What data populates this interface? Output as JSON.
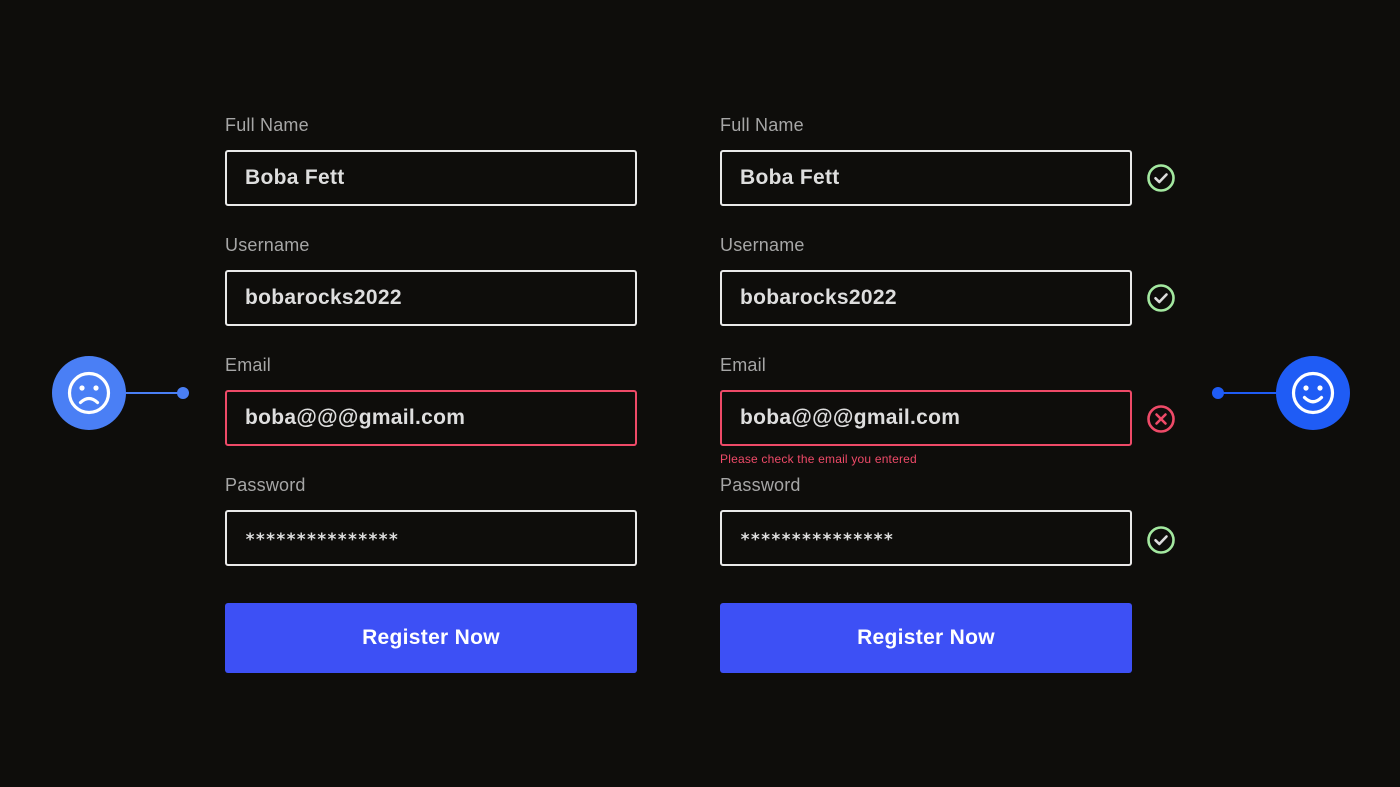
{
  "colors": {
    "background": "#0e0d0b",
    "field_border": "#e9e9e9",
    "error": "#ee4a68",
    "success": "#a3e8a0",
    "button": "#3d50f5",
    "sad_face": "#4a7ff5",
    "happy_face": "#1f5cf5"
  },
  "forms": {
    "left": {
      "full_name_label": "Full Name",
      "full_name_value": "Boba Fett",
      "username_label": "Username",
      "username_value": "bobarocks2022",
      "email_label": "Email",
      "email_value": "boba@@@gmail.com",
      "password_label": "Password",
      "password_value": "***************",
      "submit_label": "Register Now"
    },
    "right": {
      "full_name_label": "Full Name",
      "full_name_value": "Boba Fett",
      "username_label": "Username",
      "username_value": "bobarocks2022",
      "email_label": "Email",
      "email_value": "boba@@@gmail.com",
      "email_error": "Please check the email you entered",
      "password_label": "Password",
      "password_value": "***************",
      "submit_label": "Register Now"
    }
  },
  "icons": {
    "left_indicator": "sad-face-icon",
    "right_indicator": "happy-face-icon",
    "valid": "check-circle-icon",
    "invalid": "x-circle-icon"
  }
}
